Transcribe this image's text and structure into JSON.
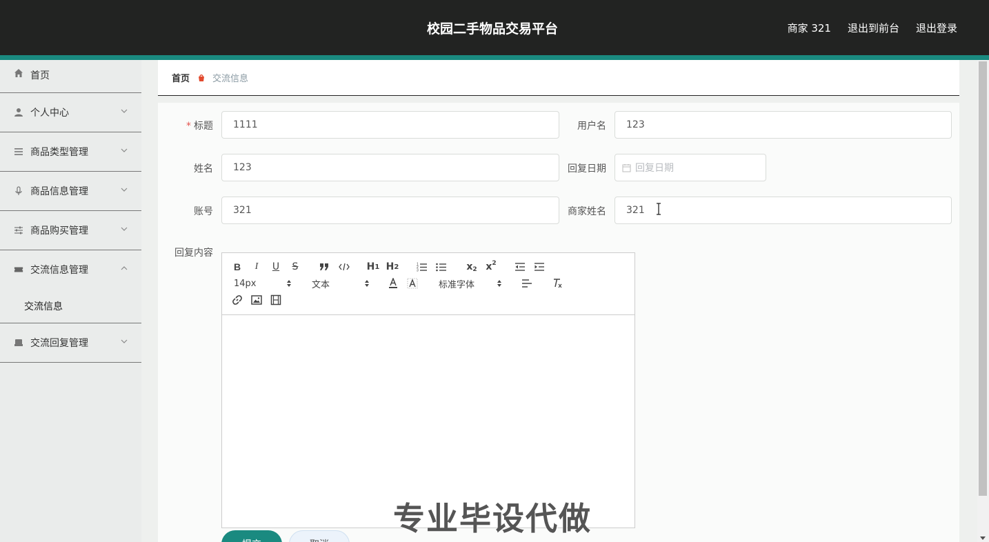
{
  "header": {
    "title": "校园二手物品交易平台",
    "user": "商家 321",
    "exit_front": "退出到前台",
    "logout": "退出登录"
  },
  "sidebar": {
    "items": [
      {
        "label": "首页",
        "icon": "home-icon"
      },
      {
        "label": "个人中心",
        "icon": "user-icon"
      },
      {
        "label": "商品类型管理",
        "icon": "list-icon"
      },
      {
        "label": "商品信息管理",
        "icon": "microphone-icon"
      },
      {
        "label": "商品购买管理",
        "icon": "sliders-icon"
      },
      {
        "label": "交流信息管理",
        "icon": "ticket-icon",
        "sub": [
          "交流信息"
        ]
      },
      {
        "label": "交流回复管理",
        "icon": "inbox-icon"
      }
    ]
  },
  "breadcrumb": {
    "home": "首页",
    "current": "交流信息"
  },
  "form": {
    "title_label": "标题",
    "title_value": "1111",
    "username_label": "用户名",
    "username_value": "123",
    "name_label": "姓名",
    "name_value": "123",
    "reply_date_label": "回复日期",
    "reply_date_placeholder": "回复日期",
    "account_label": "账号",
    "account_value": "321",
    "merchant_name_label": "商家姓名",
    "merchant_name_value": "321",
    "reply_content_label": "回复内容"
  },
  "editor": {
    "font_size": "14px",
    "text_style": "文本",
    "font_family": "标准字体"
  },
  "buttons": {
    "submit": "提交",
    "cancel": "取消"
  },
  "watermark": "专业毕设代做",
  "colors": {
    "header_bg": "#222322",
    "accent": "#1a8a80",
    "sidebar_bg": "#eaeceb",
    "required": "#e4544f"
  }
}
